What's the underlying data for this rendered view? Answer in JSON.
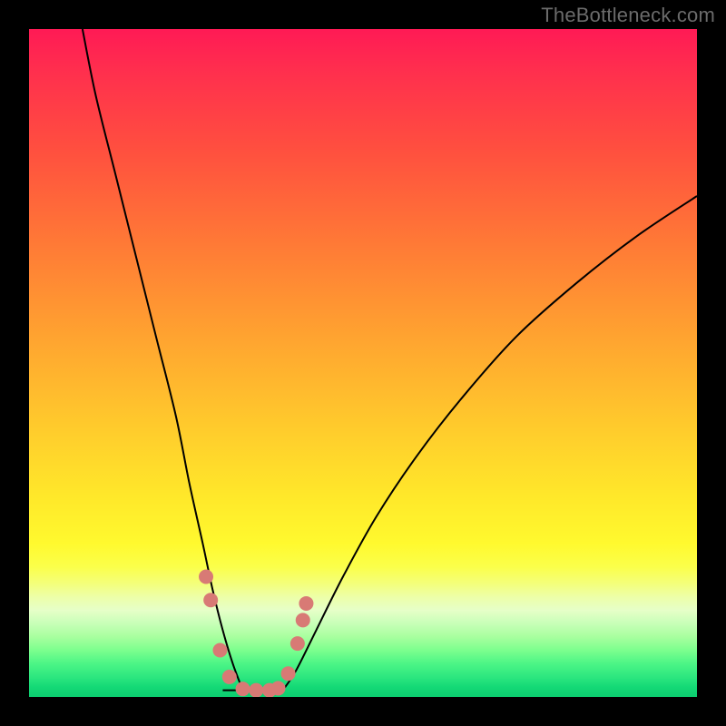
{
  "watermark": "TheBottleneck.com",
  "chart_data": {
    "type": "line",
    "title": "",
    "xlabel": "",
    "ylabel": "",
    "xlim": [
      0,
      100
    ],
    "ylim": [
      0,
      100
    ],
    "grid": false,
    "legend": false,
    "background_gradient": {
      "orientation": "vertical",
      "stops": [
        {
          "pos": 0,
          "color": "#ff1a55"
        },
        {
          "pos": 18,
          "color": "#ff4f3f"
        },
        {
          "pos": 46,
          "color": "#ffa330"
        },
        {
          "pos": 70,
          "color": "#ffe82a"
        },
        {
          "pos": 85,
          "color": "#edffa8"
        },
        {
          "pos": 95,
          "color": "#4cf586"
        },
        {
          "pos": 100,
          "color": "#0cce70"
        }
      ]
    },
    "series": [
      {
        "name": "left-curve",
        "x": [
          8,
          10,
          13,
          16,
          19,
          22,
          24,
          26,
          27.5,
          29,
          30.5,
          32
        ],
        "values": [
          100,
          90,
          78,
          66,
          54,
          42,
          32,
          23,
          16,
          10,
          5,
          1
        ],
        "stroke": "#000000"
      },
      {
        "name": "right-curve",
        "x": [
          38,
          40,
          43,
          47,
          52,
          58,
          65,
          73,
          82,
          91,
          100
        ],
        "values": [
          1,
          4,
          10,
          18,
          27,
          36,
          45,
          54,
          62,
          69,
          75
        ],
        "stroke": "#000000"
      }
    ],
    "floor_segment": {
      "name": "valley-floor",
      "x": [
        29,
        38
      ],
      "values": [
        1,
        1
      ],
      "stroke": "#000000"
    },
    "marker_series": {
      "name": "valley-markers",
      "color": "#d87a75",
      "radius_px": 8,
      "points": [
        {
          "x": 26.5,
          "y": 18
        },
        {
          "x": 27.2,
          "y": 14.5
        },
        {
          "x": 28.6,
          "y": 7
        },
        {
          "x": 30.0,
          "y": 3
        },
        {
          "x": 32.0,
          "y": 1.2
        },
        {
          "x": 34.0,
          "y": 1.0
        },
        {
          "x": 36.0,
          "y": 1.0
        },
        {
          "x": 37.3,
          "y": 1.3
        },
        {
          "x": 38.8,
          "y": 3.5
        },
        {
          "x": 40.2,
          "y": 8
        },
        {
          "x": 41.0,
          "y": 11.5
        },
        {
          "x": 41.5,
          "y": 14
        }
      ]
    }
  }
}
